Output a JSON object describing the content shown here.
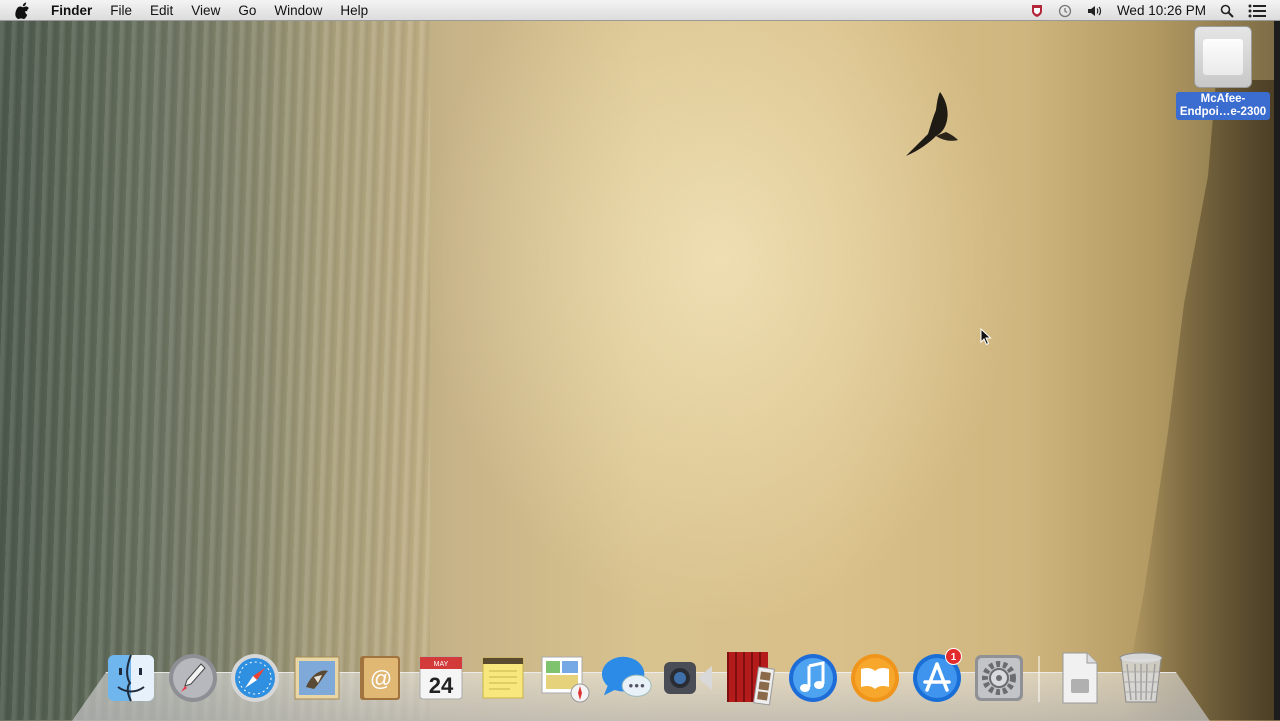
{
  "menubar": {
    "app_name": "Finder",
    "menus": [
      "File",
      "Edit",
      "View",
      "Go",
      "Window",
      "Help"
    ],
    "clock": "Wed 10:26 PM",
    "status_icons": [
      "mcafee-shield-icon",
      "time-machine-icon",
      "volume-icon",
      "spotlight-icon",
      "notification-center-icon"
    ]
  },
  "desktop": {
    "drive": {
      "label_line1": "McAfee-",
      "label_line2": "Endpoi…e-2300"
    }
  },
  "dock": {
    "apps": [
      {
        "name": "Finder",
        "icon": "finder-icon"
      },
      {
        "name": "Launchpad",
        "icon": "launchpad-icon"
      },
      {
        "name": "Safari",
        "icon": "safari-icon"
      },
      {
        "name": "Mail",
        "icon": "mail-icon"
      },
      {
        "name": "Contacts",
        "icon": "contacts-icon"
      },
      {
        "name": "Calendar",
        "icon": "calendar-icon",
        "month": "MAY",
        "day": "24"
      },
      {
        "name": "Notes",
        "icon": "notes-icon"
      },
      {
        "name": "Reminders",
        "icon": "reminders-icon"
      },
      {
        "name": "Messages",
        "icon": "messages-icon"
      },
      {
        "name": "FaceTime",
        "icon": "facetime-icon"
      },
      {
        "name": "Photo Booth",
        "icon": "photo-booth-icon"
      },
      {
        "name": "iTunes",
        "icon": "itunes-icon"
      },
      {
        "name": "iBooks",
        "icon": "ibooks-icon"
      },
      {
        "name": "App Store",
        "icon": "app-store-icon",
        "badge": "1"
      },
      {
        "name": "System Preferences",
        "icon": "system-preferences-icon"
      }
    ],
    "others": [
      {
        "name": "Documents",
        "icon": "document-stack-icon"
      },
      {
        "name": "Trash",
        "icon": "trash-icon"
      }
    ]
  },
  "colors": {
    "menubar_bg": "#e8e8e8",
    "selection_blue": "#3b6ccf",
    "badge_red": "#e32b2b"
  }
}
